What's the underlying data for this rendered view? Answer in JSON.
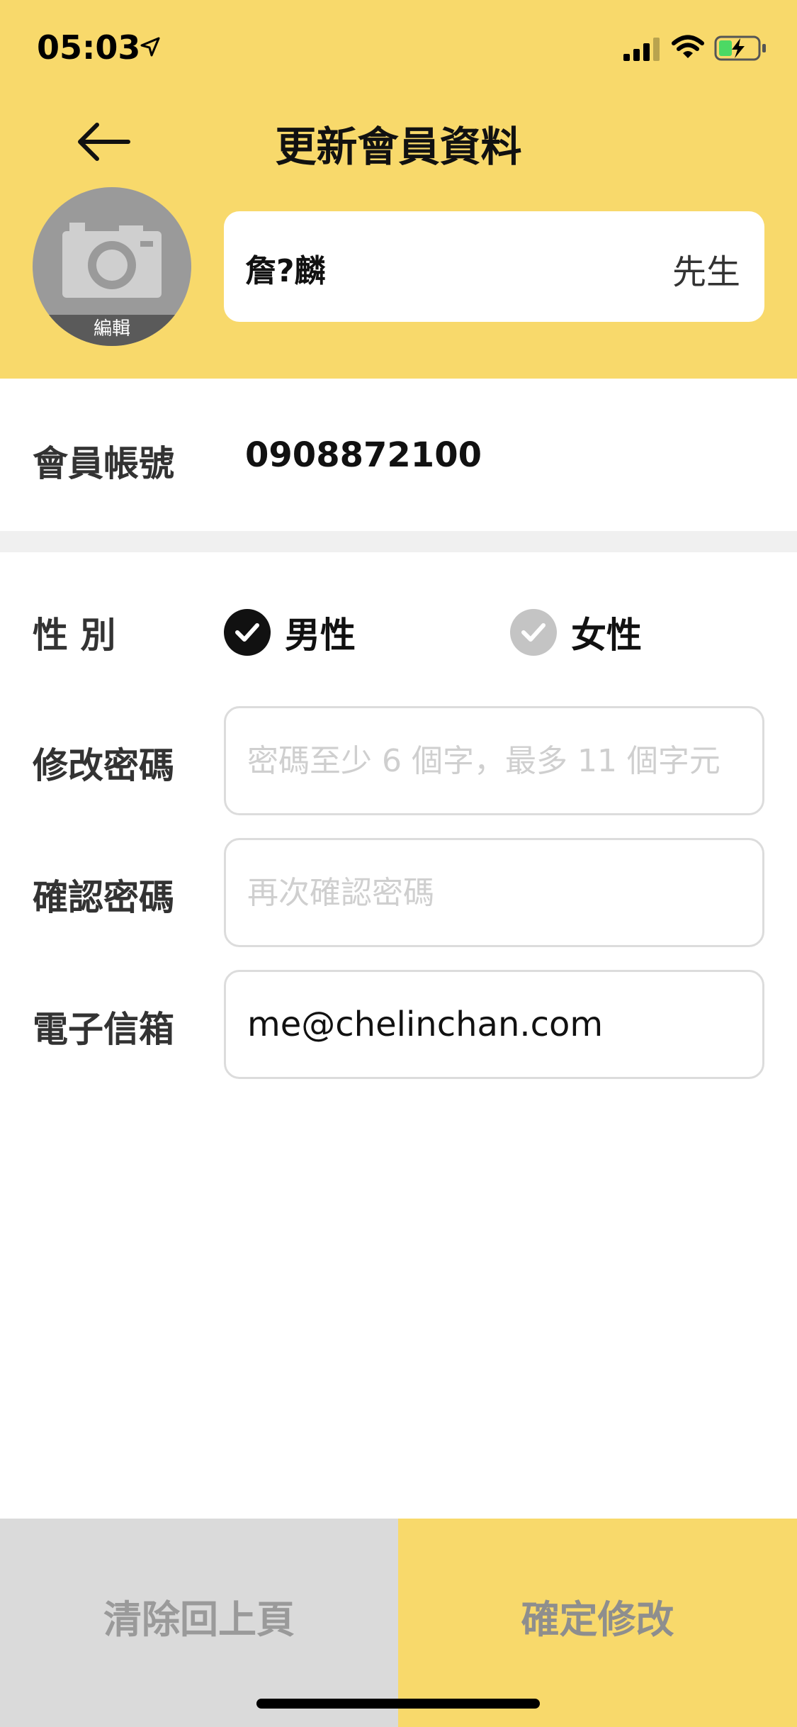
{
  "status_bar": {
    "time": "05:03",
    "icons": [
      "location-arrow-icon",
      "cellular-signal-icon",
      "wifi-icon",
      "battery-charging-icon"
    ]
  },
  "header": {
    "title": "更新會員資料",
    "back_icon": "back-arrow-icon"
  },
  "profile": {
    "avatar_icon": "camera-icon",
    "avatar_edit_label": "編輯",
    "name": "詹?麟",
    "title": "先生"
  },
  "account": {
    "label": "會員帳號",
    "value": "0908872100"
  },
  "gender": {
    "label": "性 別",
    "options": [
      {
        "label": "男性",
        "selected": true
      },
      {
        "label": "女性",
        "selected": false
      }
    ]
  },
  "password": {
    "label": "修改密碼",
    "placeholder": "密碼至少 6 個字，最多 11 個字元",
    "value": ""
  },
  "confirm_password": {
    "label": "確認密碼",
    "placeholder": "再次確認密碼",
    "value": ""
  },
  "email": {
    "label": "電子信箱",
    "value": "me@chelinchan.com"
  },
  "actions": {
    "clear_label": "清除回上頁",
    "confirm_label": "確定修改"
  },
  "colors": {
    "brand_yellow": "#F8D96B",
    "selected_radio": "#111111",
    "unselected_radio": "#c4c4c4"
  }
}
